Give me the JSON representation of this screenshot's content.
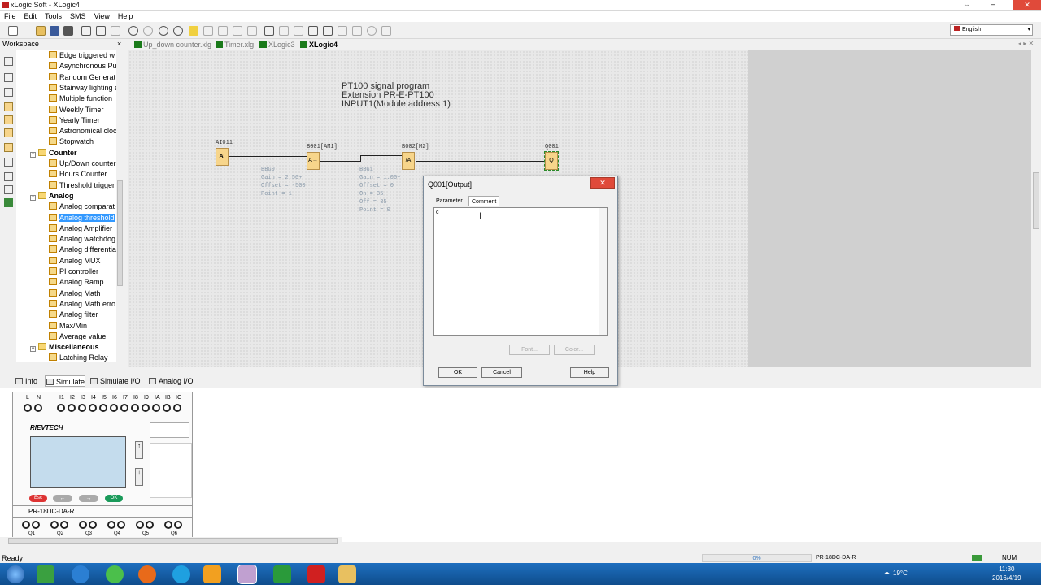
{
  "window": {
    "title": "xLogic Soft - XLogic4"
  },
  "menu": [
    "File",
    "Edit",
    "Tools",
    "SMS",
    "View",
    "Help"
  ],
  "toolbar": {
    "language": "English"
  },
  "workspace": {
    "title": "Workspace",
    "close": "×",
    "items": [
      {
        "label": "Edge triggered w",
        "type": "item"
      },
      {
        "label": "Asynchronous Pul",
        "type": "item"
      },
      {
        "label": "Random Generat",
        "type": "item"
      },
      {
        "label": "Stairway lighting s",
        "type": "item"
      },
      {
        "label": "Multiple function",
        "type": "item"
      },
      {
        "label": "Weekly Timer",
        "type": "item"
      },
      {
        "label": "Yearly Timer",
        "type": "item"
      },
      {
        "label": "Astronomical cloc",
        "type": "item"
      },
      {
        "label": "Stopwatch",
        "type": "item"
      },
      {
        "label": "Counter",
        "type": "folder"
      },
      {
        "label": "Up/Down counter",
        "type": "item"
      },
      {
        "label": "Hours Counter",
        "type": "item"
      },
      {
        "label": "Threshold trigger",
        "type": "item"
      },
      {
        "label": "Analog",
        "type": "folder"
      },
      {
        "label": "Analog comparat",
        "type": "item"
      },
      {
        "label": "Analog threshold",
        "type": "item",
        "selected": true
      },
      {
        "label": "Analog Amplifier",
        "type": "item"
      },
      {
        "label": "Analog watchdog",
        "type": "item"
      },
      {
        "label": "Analog differentia",
        "type": "item"
      },
      {
        "label": "Analog MUX",
        "type": "item"
      },
      {
        "label": "PI controller",
        "type": "item"
      },
      {
        "label": "Analog Ramp",
        "type": "item"
      },
      {
        "label": "Analog Math",
        "type": "item"
      },
      {
        "label": "Analog Math erro",
        "type": "item"
      },
      {
        "label": "Analog filter",
        "type": "item"
      },
      {
        "label": "Max/Min",
        "type": "item"
      },
      {
        "label": "Average value",
        "type": "item"
      },
      {
        "label": "Miscellaneous",
        "type": "folder"
      },
      {
        "label": "Latching Relay",
        "type": "item"
      }
    ]
  },
  "tabs": [
    {
      "label": "Up_down counter.xlg",
      "active": false
    },
    {
      "label": "Timer.xlg",
      "active": false
    },
    {
      "label": "XLogic3",
      "active": false
    },
    {
      "label": "XLogic4",
      "active": true
    }
  ],
  "canvas": {
    "comment_lines": [
      "PT100 signal program",
      "Extension PR-E-PT100",
      "INPUT1(Module address 1)"
    ],
    "blocks": {
      "ai": {
        "label": "AI011",
        "glyph": "AI"
      },
      "b001": {
        "label": "B001[AM1]",
        "glyph": "A→",
        "params": [
          "BBG0",
          "Gain = 2.50+",
          "Offset = -500",
          "Point = 1"
        ]
      },
      "b002": {
        "label": "B002[M2]",
        "glyph": "/A",
        "params": [
          "BBG1",
          "Gain = 1.00+",
          "Offset = 0",
          "On = 35",
          "Off = 35",
          "Point = 0"
        ]
      },
      "q001": {
        "label": "Q001",
        "glyph": "Q"
      }
    }
  },
  "dialog": {
    "title": "Q001[Output]",
    "close": "✕",
    "tabs": [
      "Parameter",
      "Comment"
    ],
    "active_tab": "Comment",
    "comment_text": "c",
    "font_button": "Font...",
    "color_button": "Color...",
    "ok": "OK",
    "cancel": "Cancel",
    "help": "Help"
  },
  "bottom_tabs": [
    "Info",
    "Simulate",
    "Simulate I/O",
    "Analog I/O"
  ],
  "plc": {
    "input_labels": [
      "L",
      "N",
      "I1",
      "I2",
      "I3",
      "I4",
      "I5",
      "I6",
      "I7",
      "I8",
      "I9",
      "IA",
      "IB",
      "IC"
    ],
    "brand": "RIEVTECH",
    "buttons": [
      "Esc",
      "←",
      "→",
      "OK"
    ],
    "model": "PR-18DC-DA-R",
    "output_labels": [
      "Q1",
      "Q2",
      "Q3",
      "Q4",
      "Q5",
      "Q6"
    ]
  },
  "status": {
    "ready": "Ready",
    "progress": "0%",
    "model": "PR-18DC-DA-R",
    "num": "NUM"
  },
  "taskbar": {
    "temperature": "19°C",
    "time": "11:30",
    "date": "2016/4/19"
  }
}
